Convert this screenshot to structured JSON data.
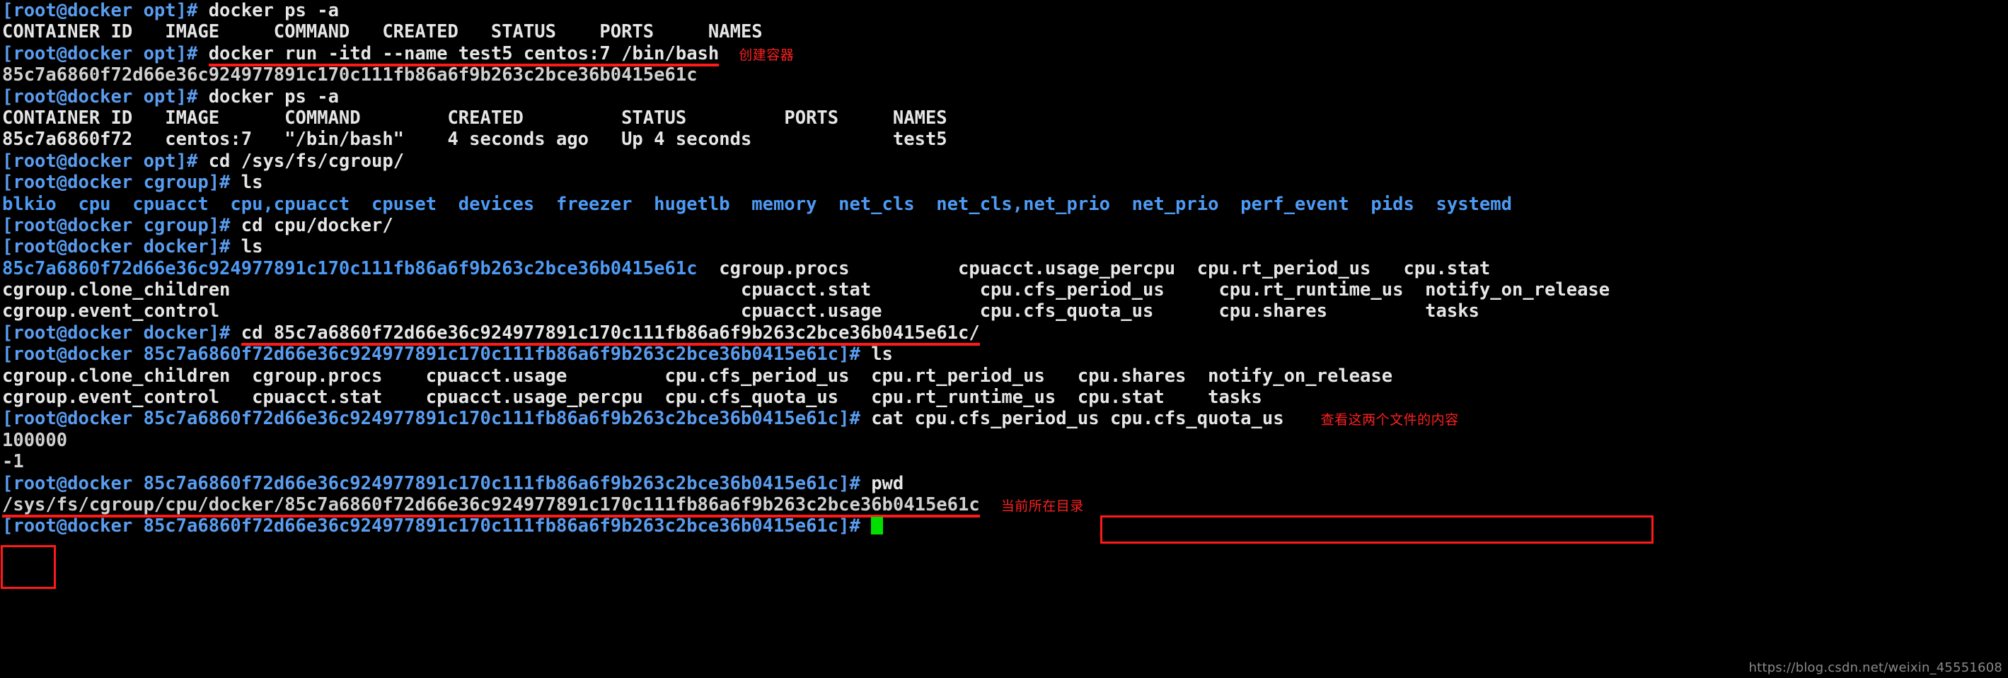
{
  "terminal": {
    "host": "root@docker",
    "container_id": "85c7a6860f72d66e36c924977891c170c111fb86a6f9b263c2bce36b0415e61c",
    "prompts": {
      "opt": "[root@docker opt]# ",
      "cgroup": "[root@docker cgroup]# ",
      "docker": "[root@docker docker]# ",
      "container_open": "[root@docker ",
      "container_close": "]# "
    },
    "lines": {
      "l01_cmd": "docker ps -a",
      "l02_header": "CONTAINER ID   IMAGE     COMMAND   CREATED   STATUS    PORTS     NAMES",
      "l03_cmd": "docker run -itd --name test5 centos:7 /bin/bash",
      "l04_out": "85c7a6860f72d66e36c924977891c170c111fb86a6f9b263c2bce36b0415e61c",
      "l05_cmd": "docker ps -a",
      "l06_header": "CONTAINER ID   IMAGE      COMMAND        CREATED         STATUS         PORTS     NAMES",
      "l07_row": "85c7a6860f72   centos:7   \"/bin/bash\"    4 seconds ago   Up 4 seconds             test5",
      "l08_cmd": "cd /sys/fs/cgroup/",
      "l09_cmd": "ls",
      "l10_out": "blkio  cpu  cpuacct  cpu,cpuacct  cpuset  devices  freezer  hugetlb  memory  net_cls  net_cls,net_prio  net_prio  perf_event  pids  systemd",
      "l11_cmd": "cd cpu/docker/",
      "l12_cmd": "ls",
      "l13_out_dir": "85c7a6860f72d66e36c924977891c170c111fb86a6f9b263c2bce36b0415e61c",
      "l13_out_rest": "  cgroup.procs          cpuacct.usage_percpu  cpu.rt_period_us   cpu.stat",
      "l14_out": "cgroup.clone_children                                               cpuacct.stat          cpu.cfs_period_us     cpu.rt_runtime_us  notify_on_release",
      "l15_out": "cgroup.event_control                                                cpuacct.usage         cpu.cfs_quota_us      cpu.shares         tasks",
      "l16_cmd": "cd 85c7a6860f72d66e36c924977891c170c111fb86a6f9b263c2bce36b0415e61c/",
      "l17_cmd": "ls",
      "l18_out": "cgroup.clone_children  cgroup.procs    cpuacct.usage         cpu.cfs_period_us  cpu.rt_period_us   cpu.shares  notify_on_release",
      "l19_out": "cgroup.event_control   cpuacct.stat    cpuacct.usage_percpu  cpu.cfs_quota_us   cpu.rt_runtime_us  cpu.stat    tasks",
      "l20_cmd": "cat cpu.cfs_period_us cpu.cfs_quota_us",
      "l21_out": "100000",
      "l22_out": "-1",
      "l23_cmd": "pwd",
      "l24_out": "/sys/fs/cgroup/cpu/docker/85c7a6860f72d66e36c924977891c170c111fb86a6f9b263c2bce36b0415e61c"
    },
    "ps_table": {
      "columns": [
        "CONTAINER ID",
        "IMAGE",
        "COMMAND",
        "CREATED",
        "STATUS",
        "PORTS",
        "NAMES"
      ],
      "rows": [
        {
          "container_id": "85c7a6860f72",
          "image": "centos:7",
          "command": "\"/bin/bash\"",
          "created": "4 seconds ago",
          "status": "Up 4 seconds",
          "ports": "",
          "names": "test5"
        }
      ]
    },
    "annotations": {
      "create_container": "创建容器",
      "view_two_files": "查看这两个文件的内容",
      "current_directory": "当前所在目录"
    },
    "colors": {
      "background": "#000000",
      "prompt": "#5a9df0",
      "directory": "#4e9bf5",
      "text": "#e6e6e6",
      "annotation": "#ff2020",
      "highlight_rule": "#ff1a1a",
      "cursor": "#00e000"
    },
    "watermark": "https://blog.csdn.net/weixin_45551608"
  }
}
